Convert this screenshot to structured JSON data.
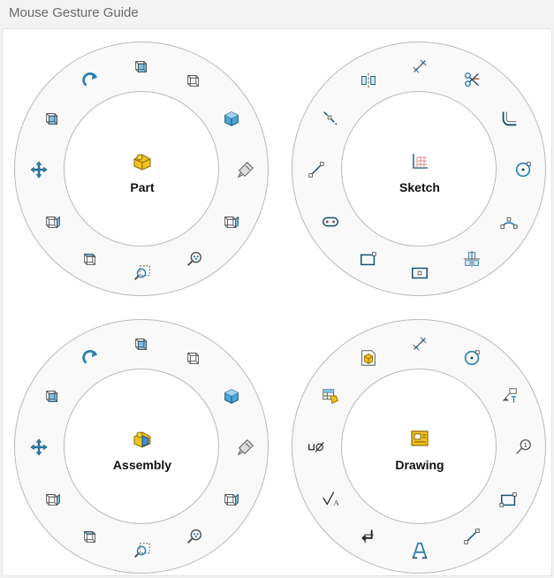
{
  "window": {
    "title": "Mouse Gesture Guide"
  },
  "wheels": [
    {
      "id": "part",
      "label": "Part",
      "center_icon": "part-icon",
      "icons": [
        "front-view-icon",
        "bottom-view-icon",
        "isometric-view-icon",
        "zoom-to-fit-icon",
        "right-view-icon",
        "zoom-to-area-icon",
        "zoom-to-selection-icon",
        "top-view-icon",
        "back-view-icon",
        "pan-icon",
        "left-view-icon",
        "rotate-view-icon"
      ]
    },
    {
      "id": "sketch",
      "label": "Sketch",
      "center_icon": "sketch-icon",
      "icons": [
        "smart-dimension-icon",
        "trim-entities-icon",
        "sketch-fillet-icon",
        "circle-icon",
        "three-point-arc-icon",
        "sketch-point-icon",
        "rectangle-center-icon",
        "corner-rectangle-icon",
        "slot-icon",
        "line-icon",
        "centerline-icon",
        "mirror-entities-icon"
      ]
    },
    {
      "id": "assembly",
      "label": "Assembly",
      "center_icon": "assembly-icon",
      "icons": [
        "front-view-icon",
        "bottom-view-icon",
        "isometric-view-icon",
        "zoom-to-fit-icon",
        "right-view-icon",
        "zoom-to-area-icon",
        "zoom-to-selection-icon",
        "top-view-icon",
        "back-view-icon",
        "pan-icon",
        "left-view-icon",
        "rotate-view-icon"
      ]
    },
    {
      "id": "drawing",
      "label": "Drawing",
      "center_icon": "drawing-icon",
      "icons": [
        "smart-dimension-icon",
        "circle-icon",
        "datum-feature-icon",
        "balloon-icon",
        "rectangle-icon",
        "line-icon",
        "note-icon",
        "alternate-position-icon",
        "surface-finish-icon",
        "hole-callout-icon",
        "bill-of-materials-icon",
        "model-items-icon"
      ]
    }
  ]
}
